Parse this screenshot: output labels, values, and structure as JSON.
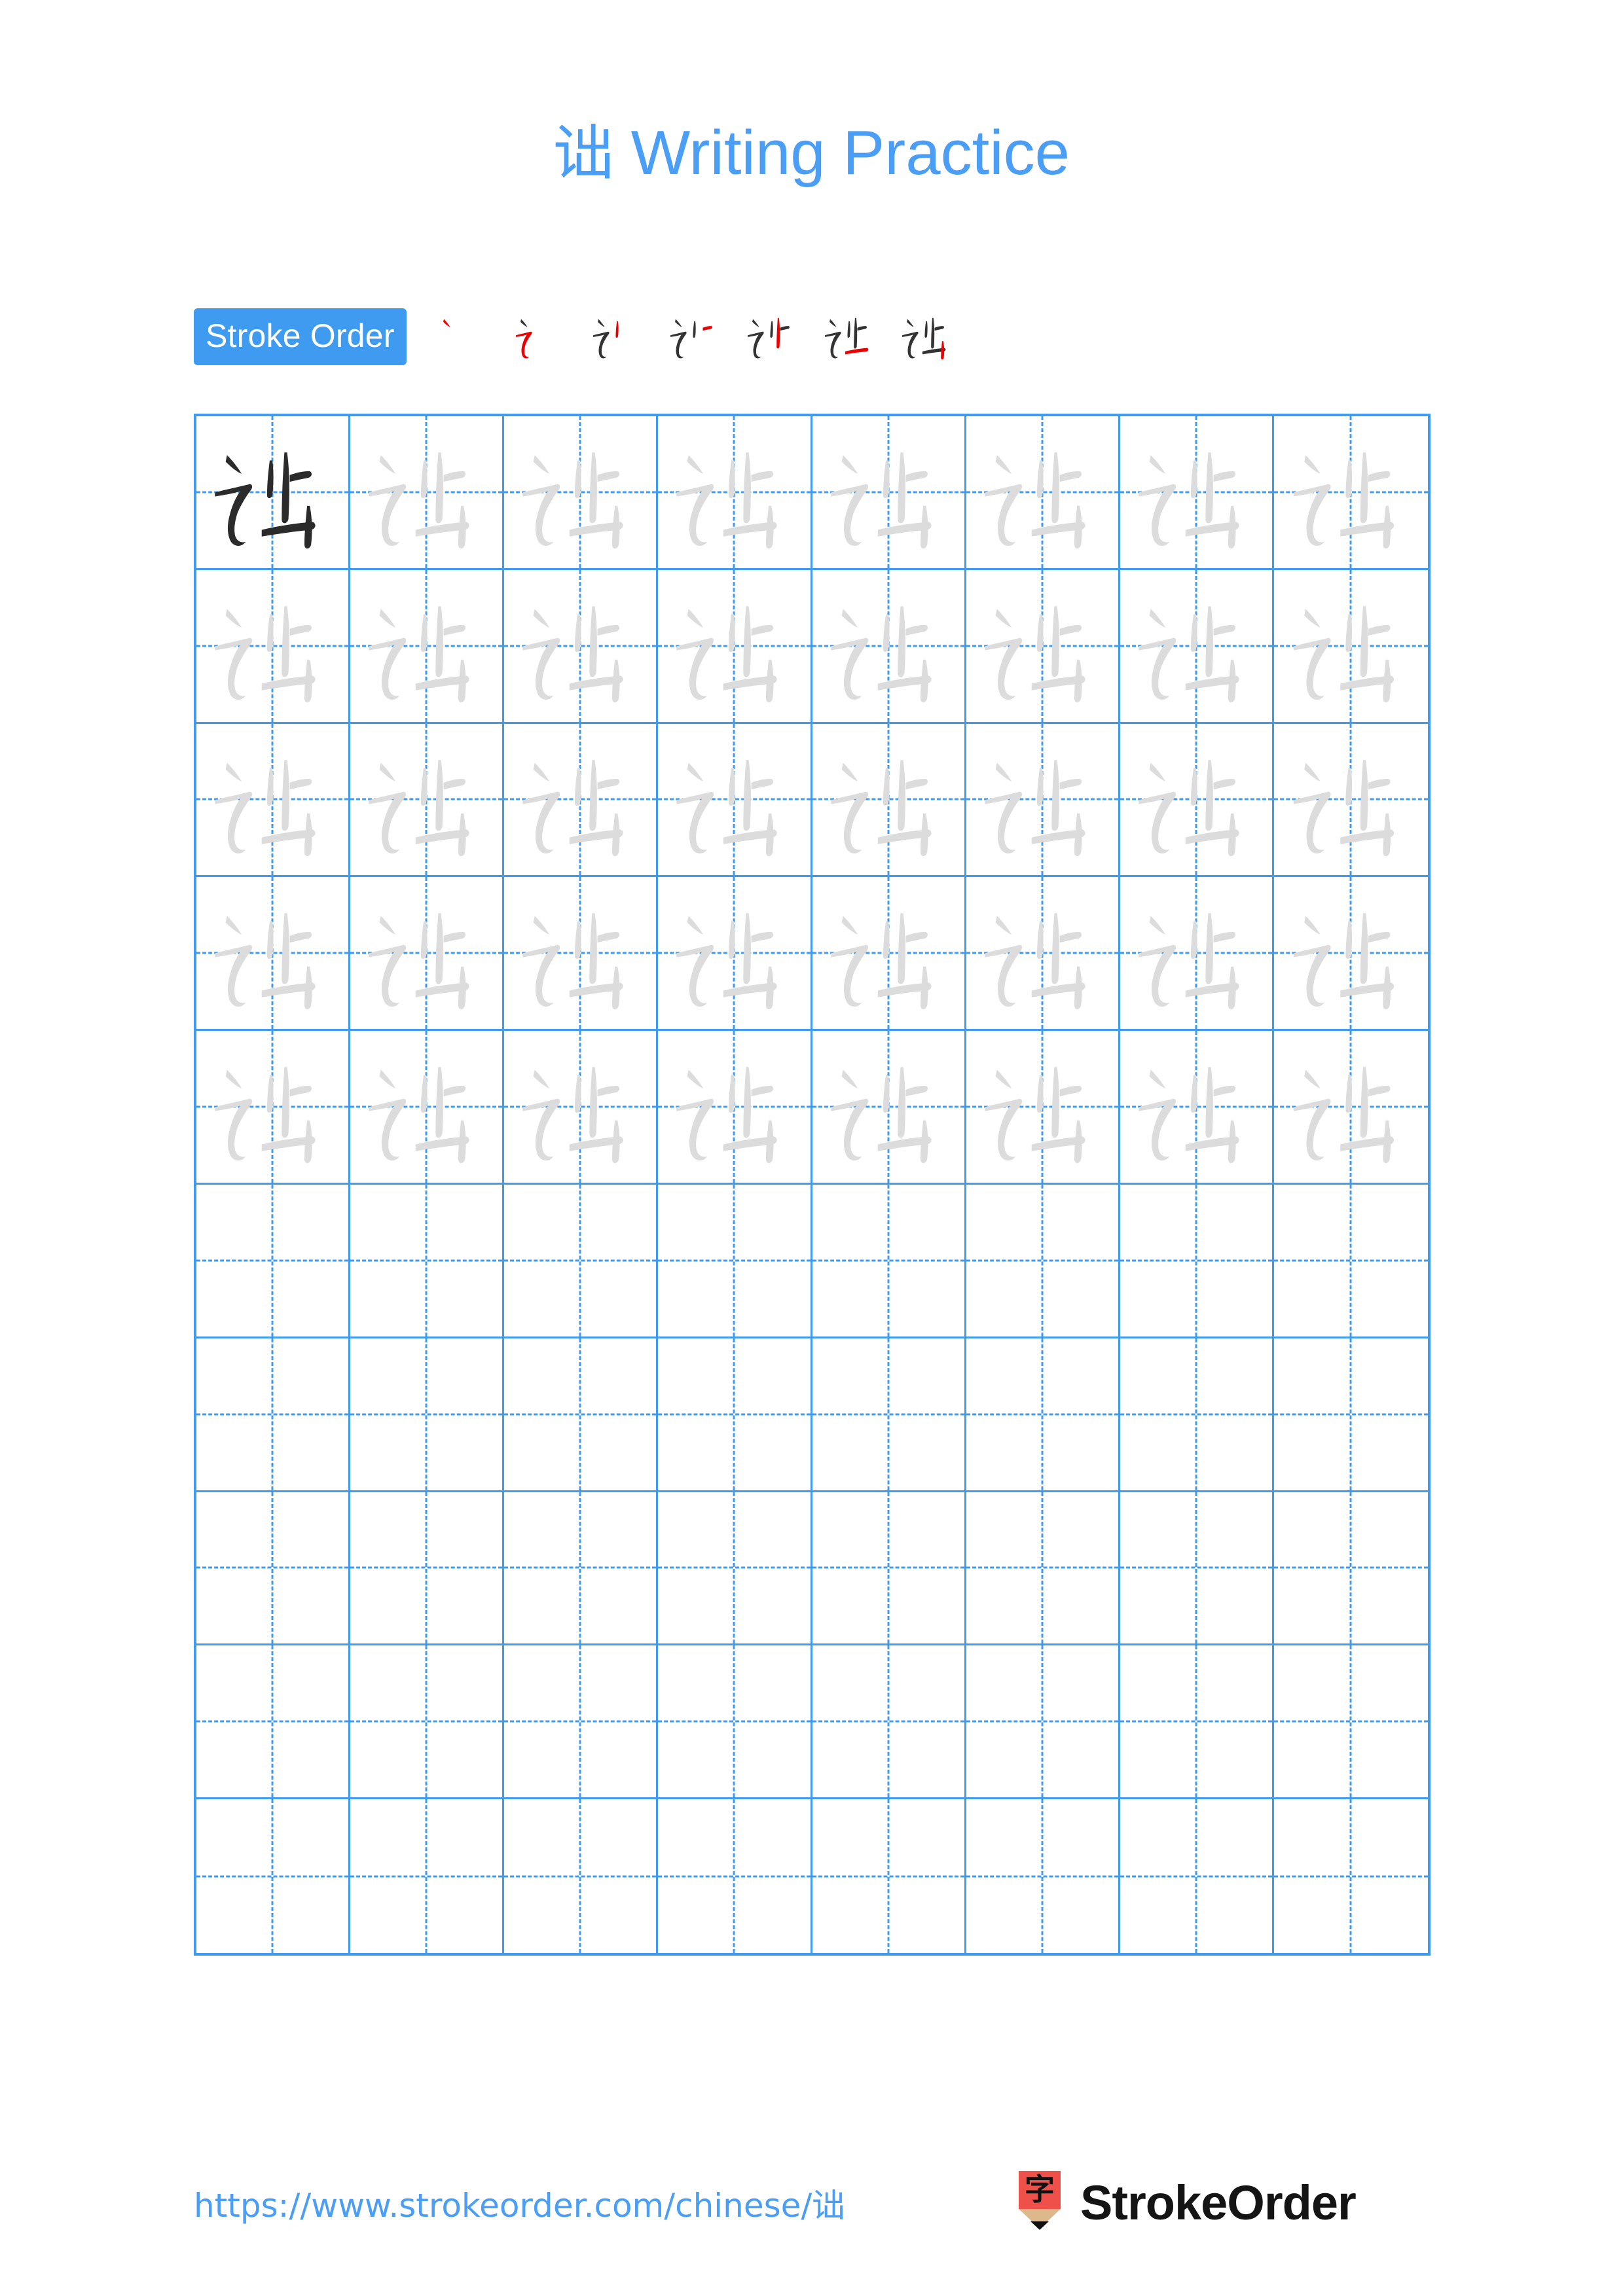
{
  "document": {
    "character": "诎",
    "title_suffix": " Writing Practice",
    "title_full": "诎 Writing Practice"
  },
  "stroke_order": {
    "badge_label": "Stroke Order",
    "stroke_count": 7,
    "new_stroke_color": "#ee0000",
    "prior_stroke_color": "#333333",
    "steps": [
      {
        "index": 1,
        "strokes_shown": 1,
        "description": "dot"
      },
      {
        "index": 2,
        "strokes_shown": 2,
        "description": "horizontal-fold-hook"
      },
      {
        "index": 3,
        "strokes_shown": 3,
        "description": "short-vertical-left"
      },
      {
        "index": 4,
        "strokes_shown": 4,
        "description": "short-horizontal"
      },
      {
        "index": 5,
        "strokes_shown": 5,
        "description": "long-vertical"
      },
      {
        "index": 6,
        "strokes_shown": 6,
        "description": "lower-horizontal"
      },
      {
        "index": 7,
        "strokes_shown": 7,
        "description": "final-vertical"
      }
    ]
  },
  "practice_grid": {
    "columns": 8,
    "rows": 10,
    "grid_line_color": "#3f9bf0",
    "dark_glyph_color": "#2b2b2b",
    "trace_glyph_color": "#dcdcdc",
    "cells": [
      [
        "dark",
        "trace",
        "trace",
        "trace",
        "trace",
        "trace",
        "trace",
        "trace"
      ],
      [
        "trace",
        "trace",
        "trace",
        "trace",
        "trace",
        "trace",
        "trace",
        "trace"
      ],
      [
        "trace",
        "trace",
        "trace",
        "trace",
        "trace",
        "trace",
        "trace",
        "trace"
      ],
      [
        "trace",
        "trace",
        "trace",
        "trace",
        "trace",
        "trace",
        "trace",
        "trace"
      ],
      [
        "trace",
        "trace",
        "trace",
        "trace",
        "trace",
        "trace",
        "trace",
        "trace"
      ],
      [
        "empty",
        "empty",
        "empty",
        "empty",
        "empty",
        "empty",
        "empty",
        "empty"
      ],
      [
        "empty",
        "empty",
        "empty",
        "empty",
        "empty",
        "empty",
        "empty",
        "empty"
      ],
      [
        "empty",
        "empty",
        "empty",
        "empty",
        "empty",
        "empty",
        "empty",
        "empty"
      ],
      [
        "empty",
        "empty",
        "empty",
        "empty",
        "empty",
        "empty",
        "empty",
        "empty"
      ],
      [
        "empty",
        "empty",
        "empty",
        "empty",
        "empty",
        "empty",
        "empty",
        "empty"
      ]
    ]
  },
  "footer": {
    "url": "https://www.strokeorder.com/chinese/诎",
    "brand_name": "StrokeOrder",
    "logo_character": "字",
    "logo_body_color": "#f0504a",
    "logo_wood_color": "#ddb88a",
    "logo_tip_color": "#111111"
  },
  "colors": {
    "accent_blue": "#3f9bf0",
    "title_blue": "#4a9ef5",
    "page_background": "#ffffff"
  }
}
